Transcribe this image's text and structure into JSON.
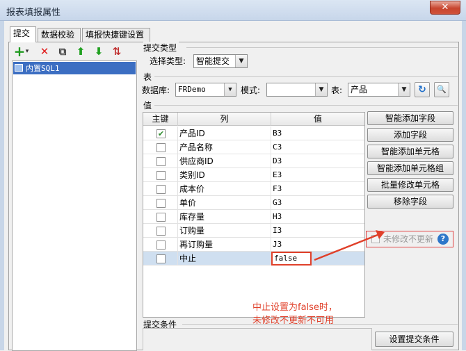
{
  "window": {
    "title": "报表填报属性",
    "close_glyph": "✕"
  },
  "tabs": [
    "提交",
    "数据校验",
    "填报快捷键设置"
  ],
  "toolbar": {
    "icons": [
      "add-icon",
      "delete-icon",
      "copy-icon",
      "move-up-icon",
      "move-down-icon",
      "sort-icon"
    ],
    "glyphs": {
      "add": "+",
      "add_caret": "▾",
      "delete": "✕",
      "copy": "⧉",
      "up": "⬆",
      "down": "⬇",
      "sort": "⇅"
    }
  },
  "list": {
    "items": [
      "内置SQL1"
    ]
  },
  "submit_type": {
    "group": "提交类型",
    "label": "选择类型:",
    "value": "智能提交"
  },
  "table_section": {
    "group": "表",
    "db_label": "数据库:",
    "db_value": "FRDemo",
    "schema_label": "模式:",
    "schema_value": "",
    "table_label": "表:",
    "table_value": "产品",
    "refresh_glyph": "↻",
    "preview_glyph": "🔍"
  },
  "values_section": {
    "group": "值",
    "headers": [
      "主键",
      "列",
      "值"
    ],
    "rows": [
      {
        "key": true,
        "col": "产品ID",
        "val": "B3"
      },
      {
        "key": false,
        "col": "产品名称",
        "val": "C3"
      },
      {
        "key": false,
        "col": "供应商ID",
        "val": "D3"
      },
      {
        "key": false,
        "col": "类别ID",
        "val": "E3"
      },
      {
        "key": false,
        "col": "成本价",
        "val": "F3"
      },
      {
        "key": false,
        "col": "单价",
        "val": "G3"
      },
      {
        "key": false,
        "col": "库存量",
        "val": "H3"
      },
      {
        "key": false,
        "col": "订购量",
        "val": "I3"
      },
      {
        "key": false,
        "col": "再订购量",
        "val": "J3"
      },
      {
        "key": false,
        "col": "中止",
        "val": "false"
      }
    ],
    "check_glyph": "✔"
  },
  "side_buttons": [
    "智能添加字段",
    "添加字段",
    "智能添加单元格",
    "智能添加单元格组",
    "批量修改单元格",
    "移除字段"
  ],
  "unmodified": {
    "label": "未修改不更新",
    "help": "?"
  },
  "annotation": {
    "line1": "中止设置为false时，",
    "line2": "未修改不更新不可用",
    "color": "#e0402a"
  },
  "submit_condition": {
    "group": "提交条件",
    "button": "设置提交条件"
  }
}
